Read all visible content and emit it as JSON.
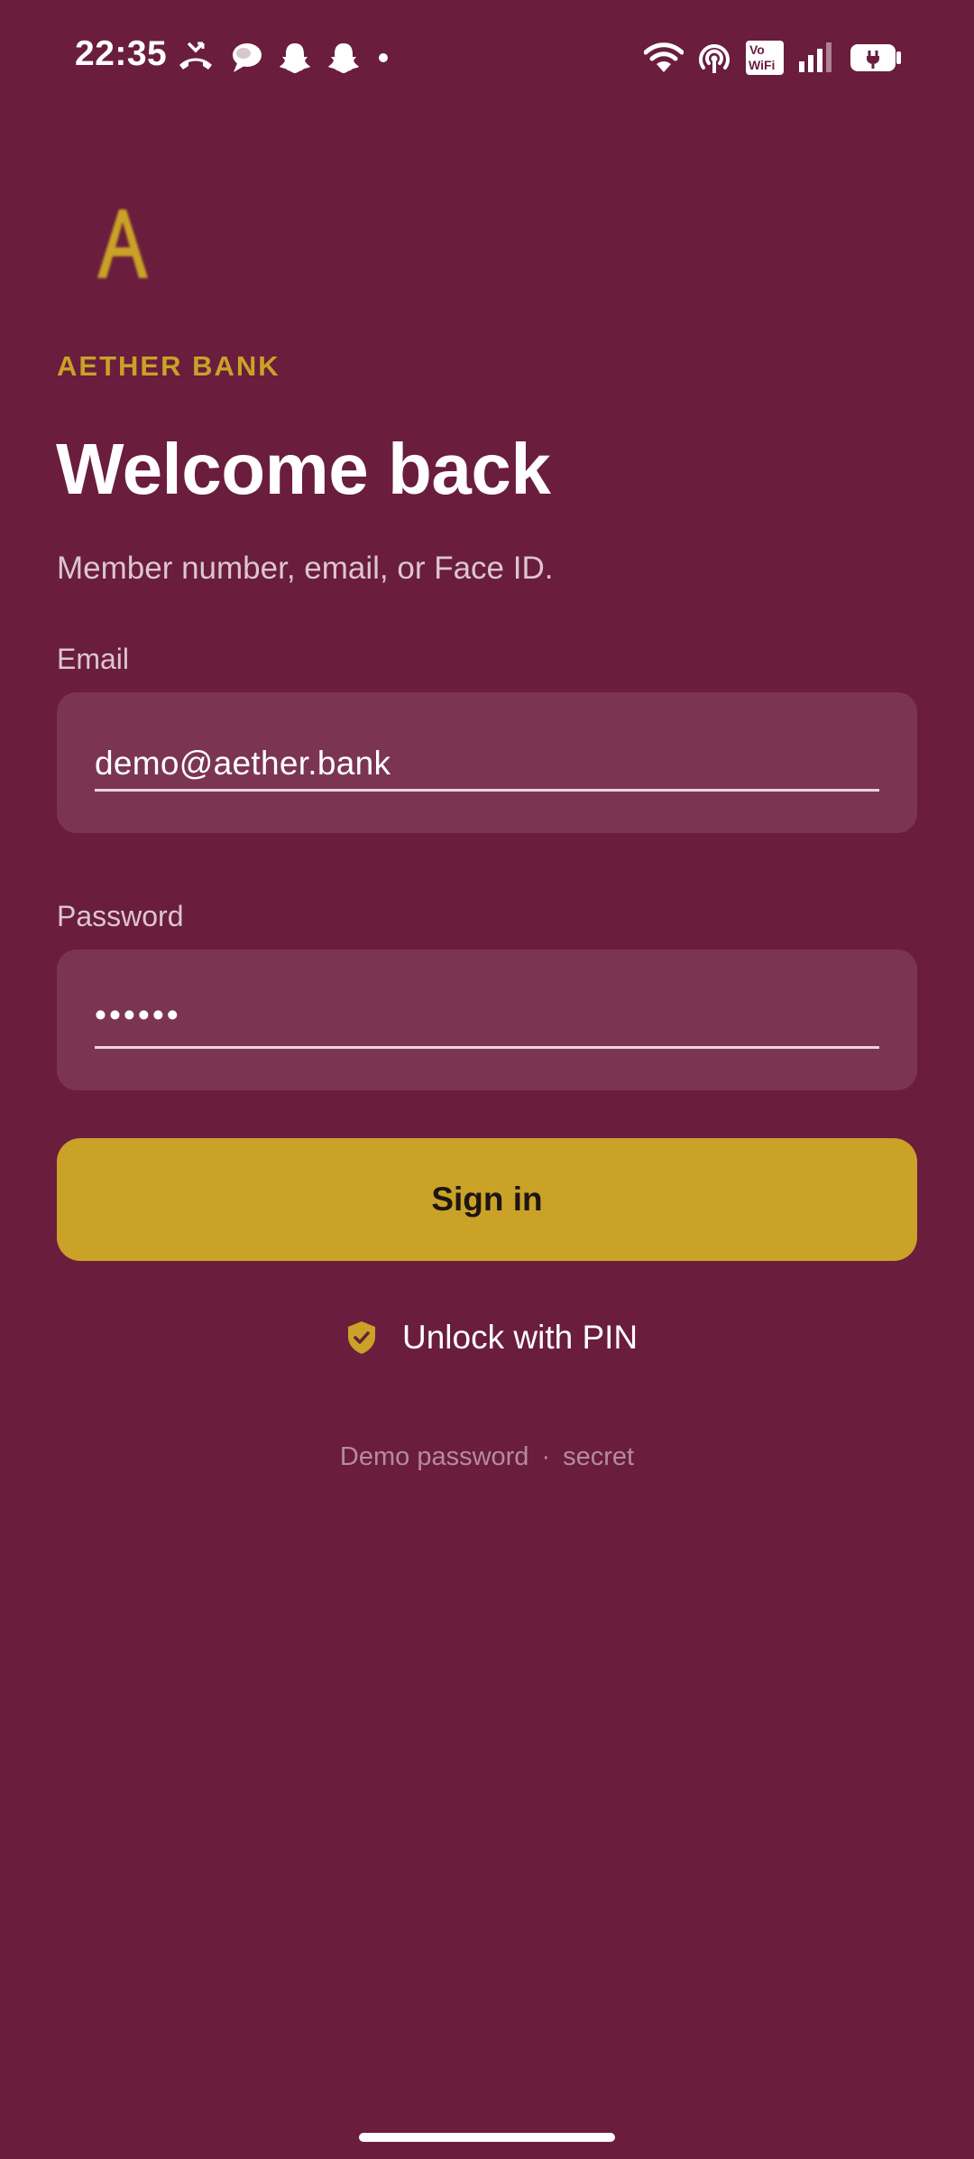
{
  "status_bar": {
    "time": "22:35",
    "left_icons": [
      "missed-call-icon",
      "chat-bubble-icon",
      "snapchat-icon",
      "snapchat-icon",
      "dot-icon"
    ],
    "right_icons": [
      "wifi-icon",
      "hotspot-icon",
      "vowifi-icon",
      "signal-icon",
      "battery-charging-icon"
    ],
    "vowifi_line1": "Vo",
    "vowifi_line2": "WiFi"
  },
  "brand": {
    "logo_letter": "A",
    "name": "AETHER BANK",
    "accent_color": "#c9a227"
  },
  "login": {
    "title": "Welcome back",
    "subtitle": "Member number, email, or Face ID.",
    "email_label": "Email",
    "email_value": "demo@aether.bank",
    "password_label": "Password",
    "password_value": "••••••",
    "signin_label": "Sign in",
    "pin_unlock_label": "Unlock with PIN",
    "demo_hint_label": "Demo password",
    "demo_hint_separator": "·",
    "demo_hint_value": "secret"
  },
  "colors": {
    "background": "#6a1d3d",
    "input_fill": "#7b3552",
    "button": "#c9a227"
  }
}
